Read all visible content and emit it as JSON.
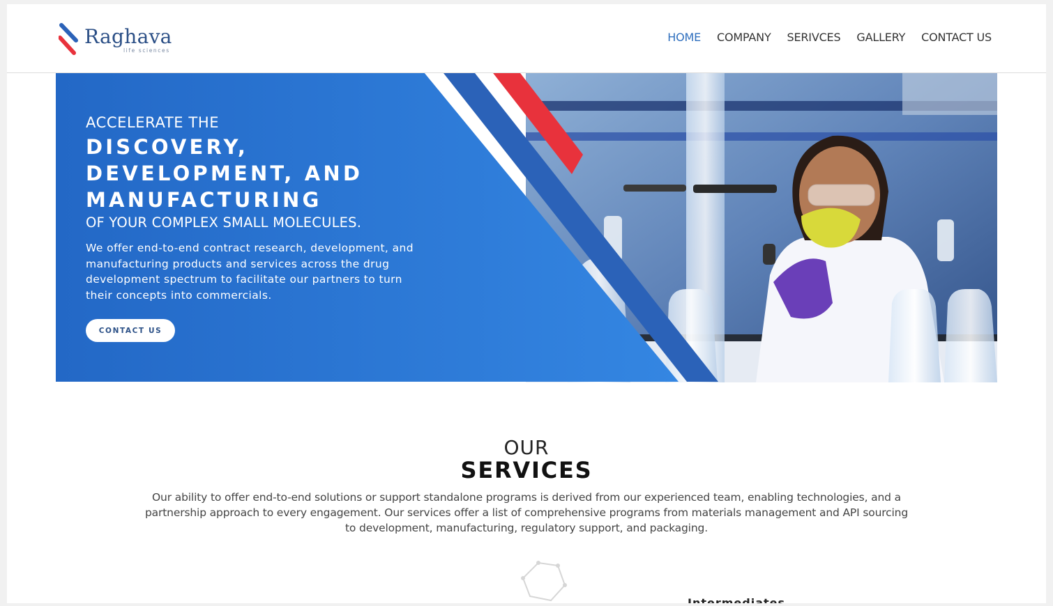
{
  "brand": {
    "name": "Raghava",
    "tagline": "life sciences",
    "colors": {
      "blue": "#2b62b8",
      "red": "#e8323c",
      "navy": "#2b4f86"
    }
  },
  "nav": {
    "items": [
      {
        "label": "HOME",
        "active": true
      },
      {
        "label": "COMPANY",
        "active": false
      },
      {
        "label": "SERIVCES",
        "active": false
      },
      {
        "label": "GALLERY",
        "active": false
      },
      {
        "label": "CONTACT US",
        "active": false
      }
    ]
  },
  "hero": {
    "kicker": "ACCELERATE THE",
    "headline_lines": [
      "DISCOVERY,",
      "DEVELOPMENT, AND",
      "MANUFACTURING"
    ],
    "subhead": "OF YOUR COMPLEX SMALL MOLECULES.",
    "description": "We offer end-to-end contract research, development, and manufacturing products and services across the drug development spectrum to facilitate our partners to turn their concepts into commercials.",
    "cta_label": "CONTACT US",
    "photo_subject": "scientist-in-lab-with-mask-and-goggles"
  },
  "services": {
    "heading_top": "OUR",
    "heading_main": "SERVICES",
    "description": "Our ability to offer end-to-end solutions or support standalone programs is derived from our experienced team, enabling technologies, and a partnership approach to every engagement. Our services offer a list of comprehensive programs from materials management and API sourcing to development, manufacturing, regulatory support, and packaging.",
    "first_item_label": "Intermediates",
    "first_item_icon": "molecule-icon"
  }
}
